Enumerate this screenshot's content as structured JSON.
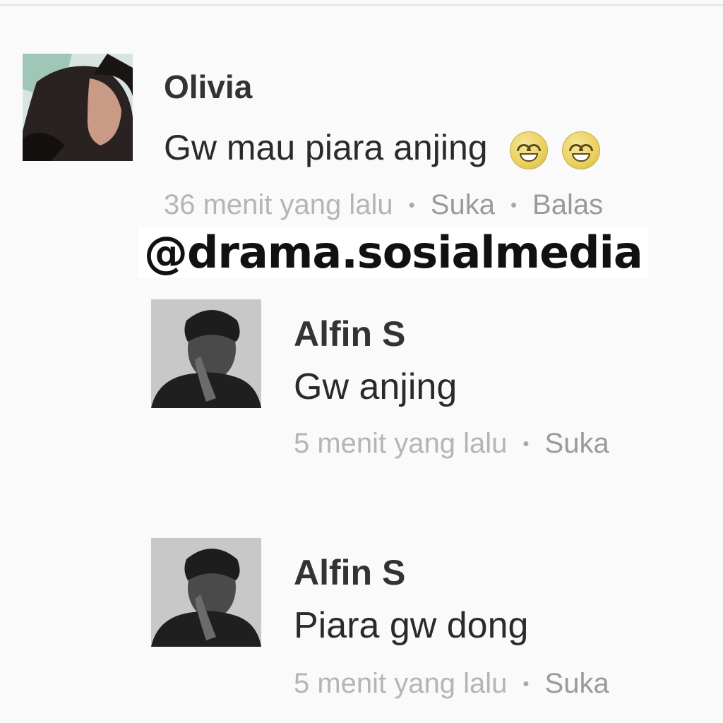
{
  "watermark": "@drama.sosialmedia",
  "comments": [
    {
      "name": "Olivia",
      "text": "Gw mau piara anjing",
      "emoji_icons": [
        "grinning-smiling-eyes-emoji",
        "grinning-smiling-eyes-emoji"
      ],
      "time": "36 menit yang lalu",
      "like_label": "Suka",
      "reply_label": "Balas"
    },
    {
      "name": "Alfin S",
      "text": "Gw anjing",
      "time": "5 menit yang lalu",
      "like_label": "Suka"
    },
    {
      "name": "Alfin S",
      "text": "Piara gw dong",
      "time": "5 menit yang lalu",
      "like_label": "Suka"
    }
  ]
}
